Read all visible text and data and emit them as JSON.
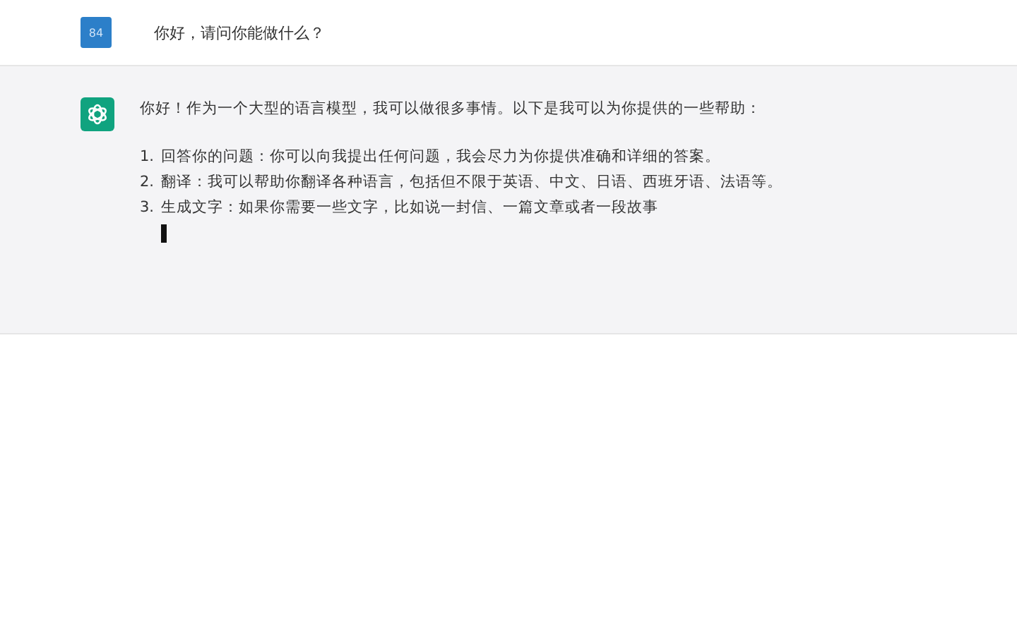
{
  "user_message": {
    "avatar": "84",
    "text": "你好，请问你能做什么？"
  },
  "reply": {
    "intro": "你好！作为一个大型的语言模型，我可以做很多事情。以下是我可以为你提供的一些帮助：",
    "items": [
      {
        "number": "1.",
        "text": "回答你的问题：你可以向我提出任何问题，我会尽力为你提供准确和详细的答案。"
      },
      {
        "number": "2.",
        "text": "翻译：我可以帮助你翻译各种语言，包括但不限于英语、中文、日语、西班牙语、法语等。"
      },
      {
        "number": "3.",
        "text": "生成文字：如果你需要一些文字，比如说一封信、一篇文章或者一段故事"
      }
    ],
    "typing": true
  }
}
